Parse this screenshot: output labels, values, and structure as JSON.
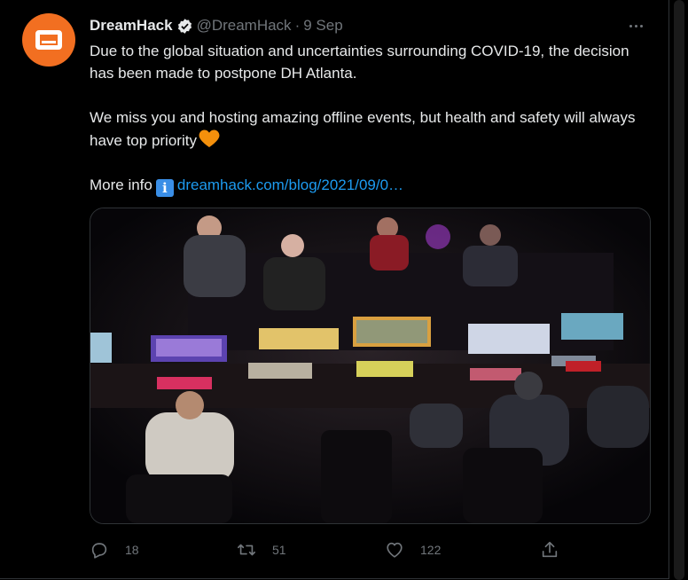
{
  "tweet": {
    "display_name": "DreamHack",
    "handle": "@DreamHack",
    "separator": "·",
    "timestamp": "9 Sep",
    "text_lines": [
      "Due to the global situation and uncertainties surrounding COVID-19, the decision has been made to postpone DH Atlanta.",
      "We miss you and hosting amazing offline events, but health and safety will always have top priority",
      "More info"
    ],
    "link_text": "dreamhack.com/blog/2021/09/0…",
    "icons": {
      "verified": "verified-badge-icon",
      "heart_emoji": "orange-heart-icon",
      "info": "information-icon",
      "more": "more-options-icon"
    },
    "colors": {
      "avatar_bg": "#f26f21",
      "link": "#1d9bf0",
      "muted": "#71767b"
    }
  },
  "actions": {
    "reply_count": "18",
    "retweet_count": "51",
    "like_count": "122"
  }
}
